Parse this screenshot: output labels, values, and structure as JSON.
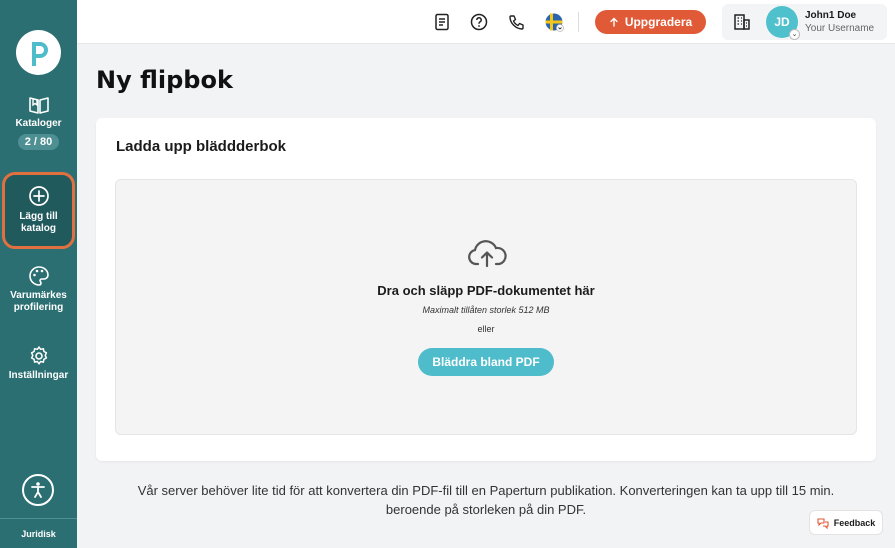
{
  "sidebar": {
    "items": [
      {
        "label": "Kataloger",
        "badge": "2 / 80",
        "icon": "book-icon"
      },
      {
        "label": "Lägg till katalog",
        "icon": "add-circle-icon"
      },
      {
        "label": "Varumärkes profilering",
        "icon": "palette-icon"
      },
      {
        "label": "Inställningar",
        "icon": "gear-icon"
      }
    ],
    "legal": "Juridisk"
  },
  "topbar": {
    "upgrade_label": "Uppgradera",
    "user": {
      "initials": "JD",
      "name": "John1 Doe",
      "subtitle": "Your Username"
    }
  },
  "main": {
    "title": "Ny flipbok",
    "card": {
      "title": "Ladda upp bläddderbok",
      "dropzone": {
        "title": "Dra och släpp PDF-dokumentet här",
        "max_size": "Maximalt tillåten storlek 512 MB",
        "or": "eller",
        "button": "Bläddra bland PDF"
      }
    },
    "note_line1": "Vår server behöver lite tid för att konvertera din PDF-fil till en Paperturn publikation. Konverteringen kan ta upp till 15 min.",
    "note_line2": "beroende på storleken på din PDF."
  },
  "feedback_label": "Feedback",
  "colors": {
    "sidebar": "#2b6f72",
    "accent": "#e15a37",
    "teal": "#4ebccb"
  }
}
